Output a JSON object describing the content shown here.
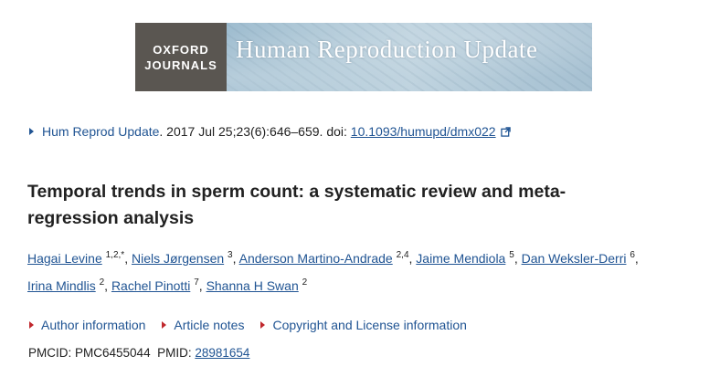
{
  "banner": {
    "publisher_line1": "OXFORD",
    "publisher_line2": "JOURNALS",
    "journal_name": "Human Reproduction Update"
  },
  "citation": {
    "journal_abbrev": "Hum Reprod Update",
    "details": ". 2017 Jul 25;23(6):646–659. doi: ",
    "doi": "10.1093/humupd/dmx022",
    "icon": "external-link-icon"
  },
  "title": "Temporal trends in sperm count: a systematic review and meta-regression analysis",
  "authors": [
    {
      "name": "Hagai Levine",
      "sup": "1,2,*"
    },
    {
      "name": "Niels Jørgensen",
      "sup": "3"
    },
    {
      "name": "Anderson Martino-Andrade",
      "sup": "2,4"
    },
    {
      "name": "Jaime Mendiola",
      "sup": "5"
    },
    {
      "name": "Dan Weksler-Derri",
      "sup": "6"
    },
    {
      "name": "Irina Mindlis",
      "sup": "2"
    },
    {
      "name": "Rachel Pinotti",
      "sup": "7"
    },
    {
      "name": "Shanna H Swan",
      "sup": "2"
    }
  ],
  "meta_links": {
    "author_information": "Author information",
    "article_notes": "Article notes",
    "copyright": "Copyright and License information"
  },
  "ids": {
    "pmcid_label": "PMCID: ",
    "pmcid": "PMC6455044",
    "pmid_label": "PMID: ",
    "pmid": "28981654"
  },
  "colors": {
    "link": "#205493",
    "expander": "#c0282d",
    "publisher_box": "#5a5651"
  }
}
